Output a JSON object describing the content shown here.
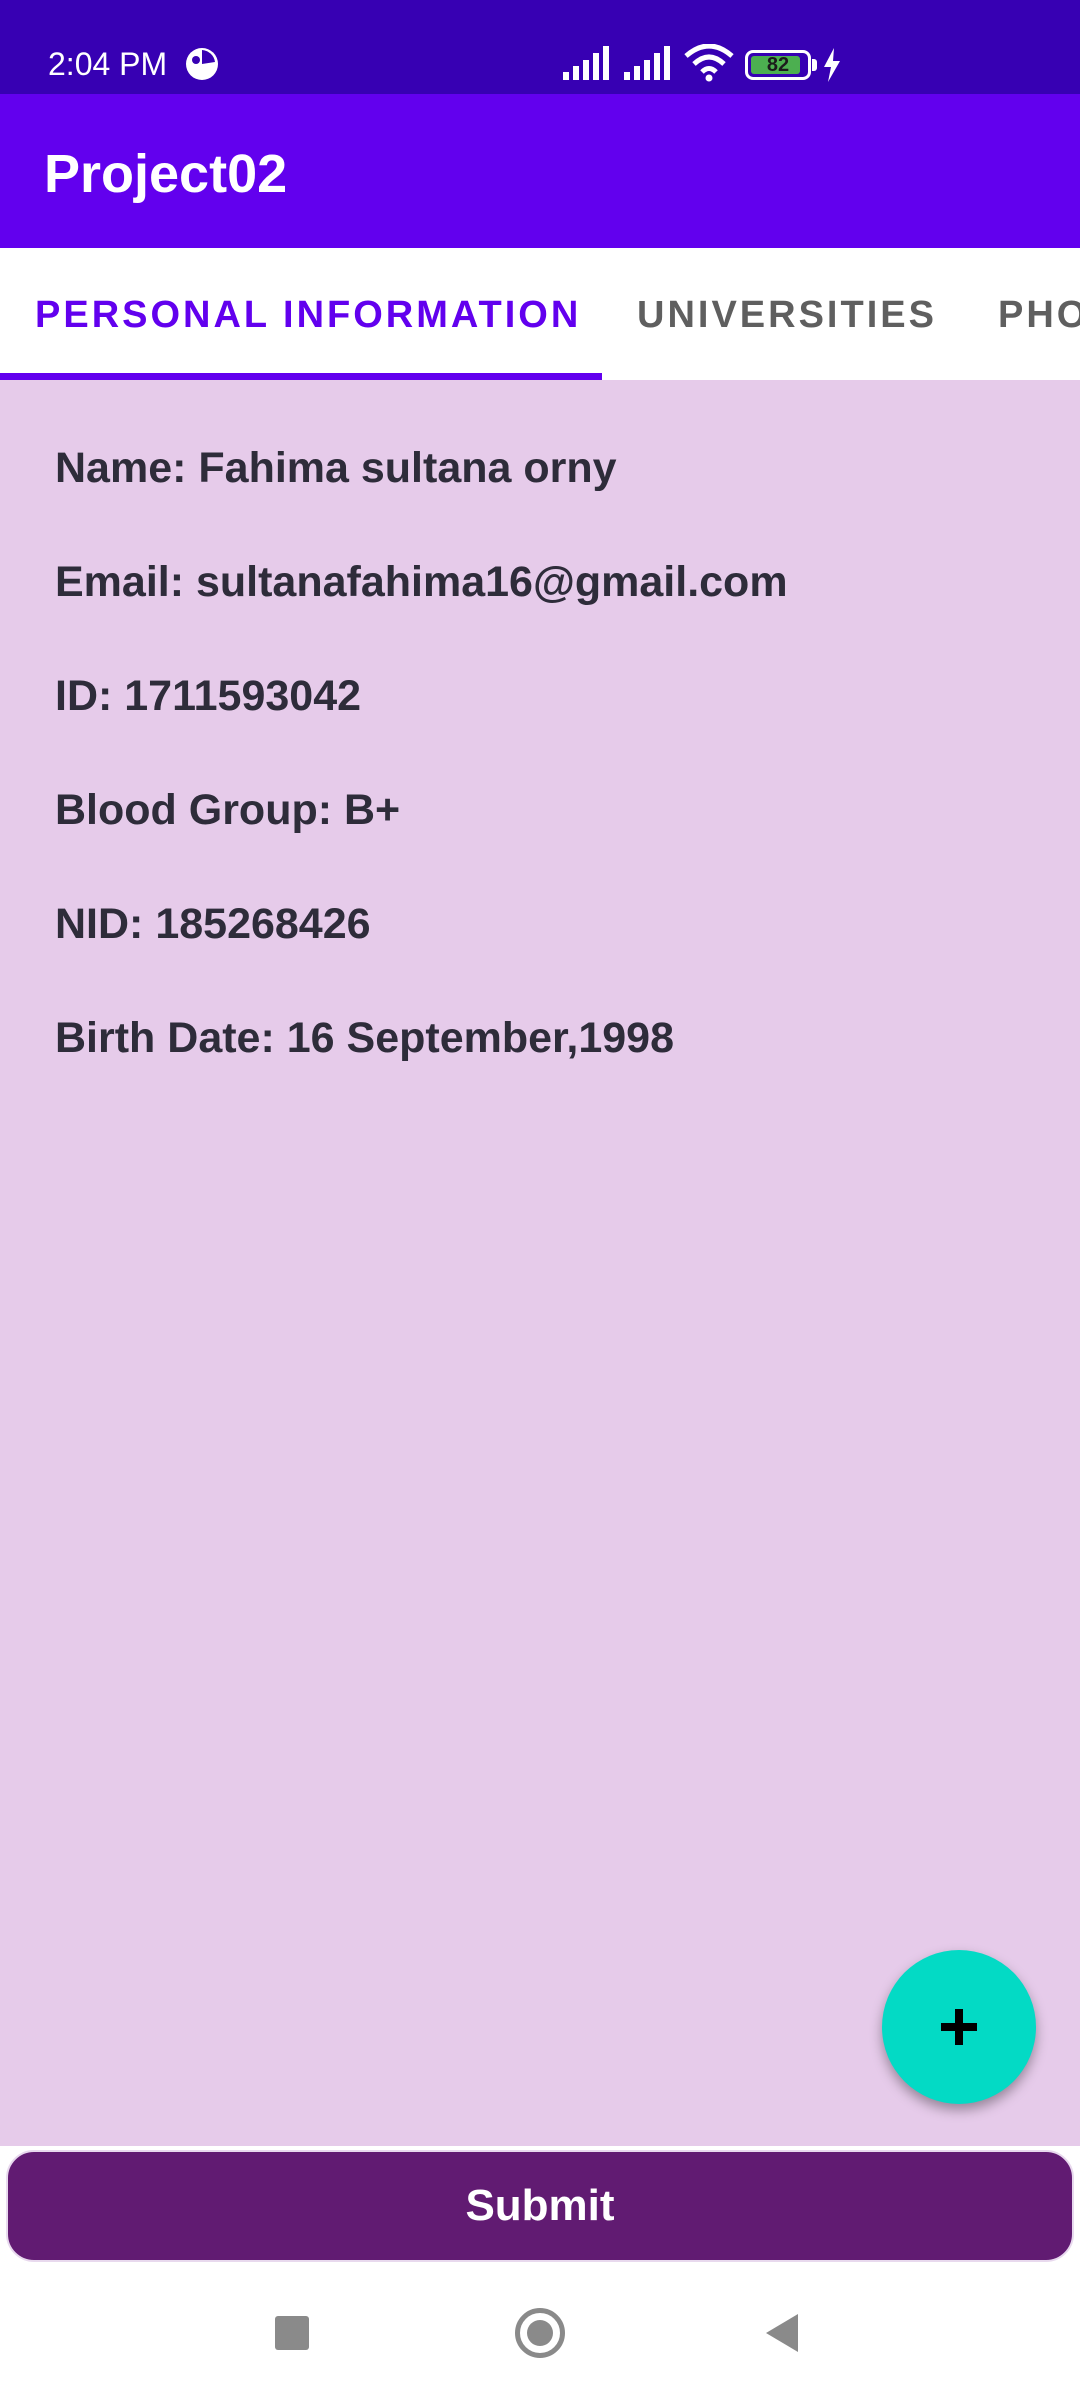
{
  "status_bar": {
    "time": "2:04 PM",
    "battery_level": "82",
    "icons": [
      "app-notification-icon",
      "signal-icon",
      "signal-icon",
      "wifi-icon",
      "battery-icon",
      "charging-bolt-icon"
    ],
    "background": "#3700b3"
  },
  "app_bar": {
    "title": "Project02",
    "background": "#6200ee"
  },
  "tabs": [
    {
      "label": "PERSONAL INFORMATION",
      "selected": true
    },
    {
      "label": "UNIVERSITIES",
      "selected": false
    },
    {
      "label": "PHO",
      "selected": false
    }
  ],
  "personal_info": {
    "name": "Name: Fahima sultana orny",
    "email": "Email: sultanafahima16@gmail.com",
    "id": "ID: 1711593042",
    "blood_group": "Blood Group: B+",
    "nid": "NID: 185268426",
    "birth_date": "Birth Date: 16 September,1998"
  },
  "fab": {
    "icon": "plus-icon",
    "color": "#03dac5"
  },
  "submit": {
    "label": "Submit",
    "color": "#611b72"
  },
  "content_background": "#e6cbea",
  "nav_bar": {
    "icons": [
      "recents-square-icon",
      "home-circle-icon",
      "back-triangle-icon"
    ]
  }
}
